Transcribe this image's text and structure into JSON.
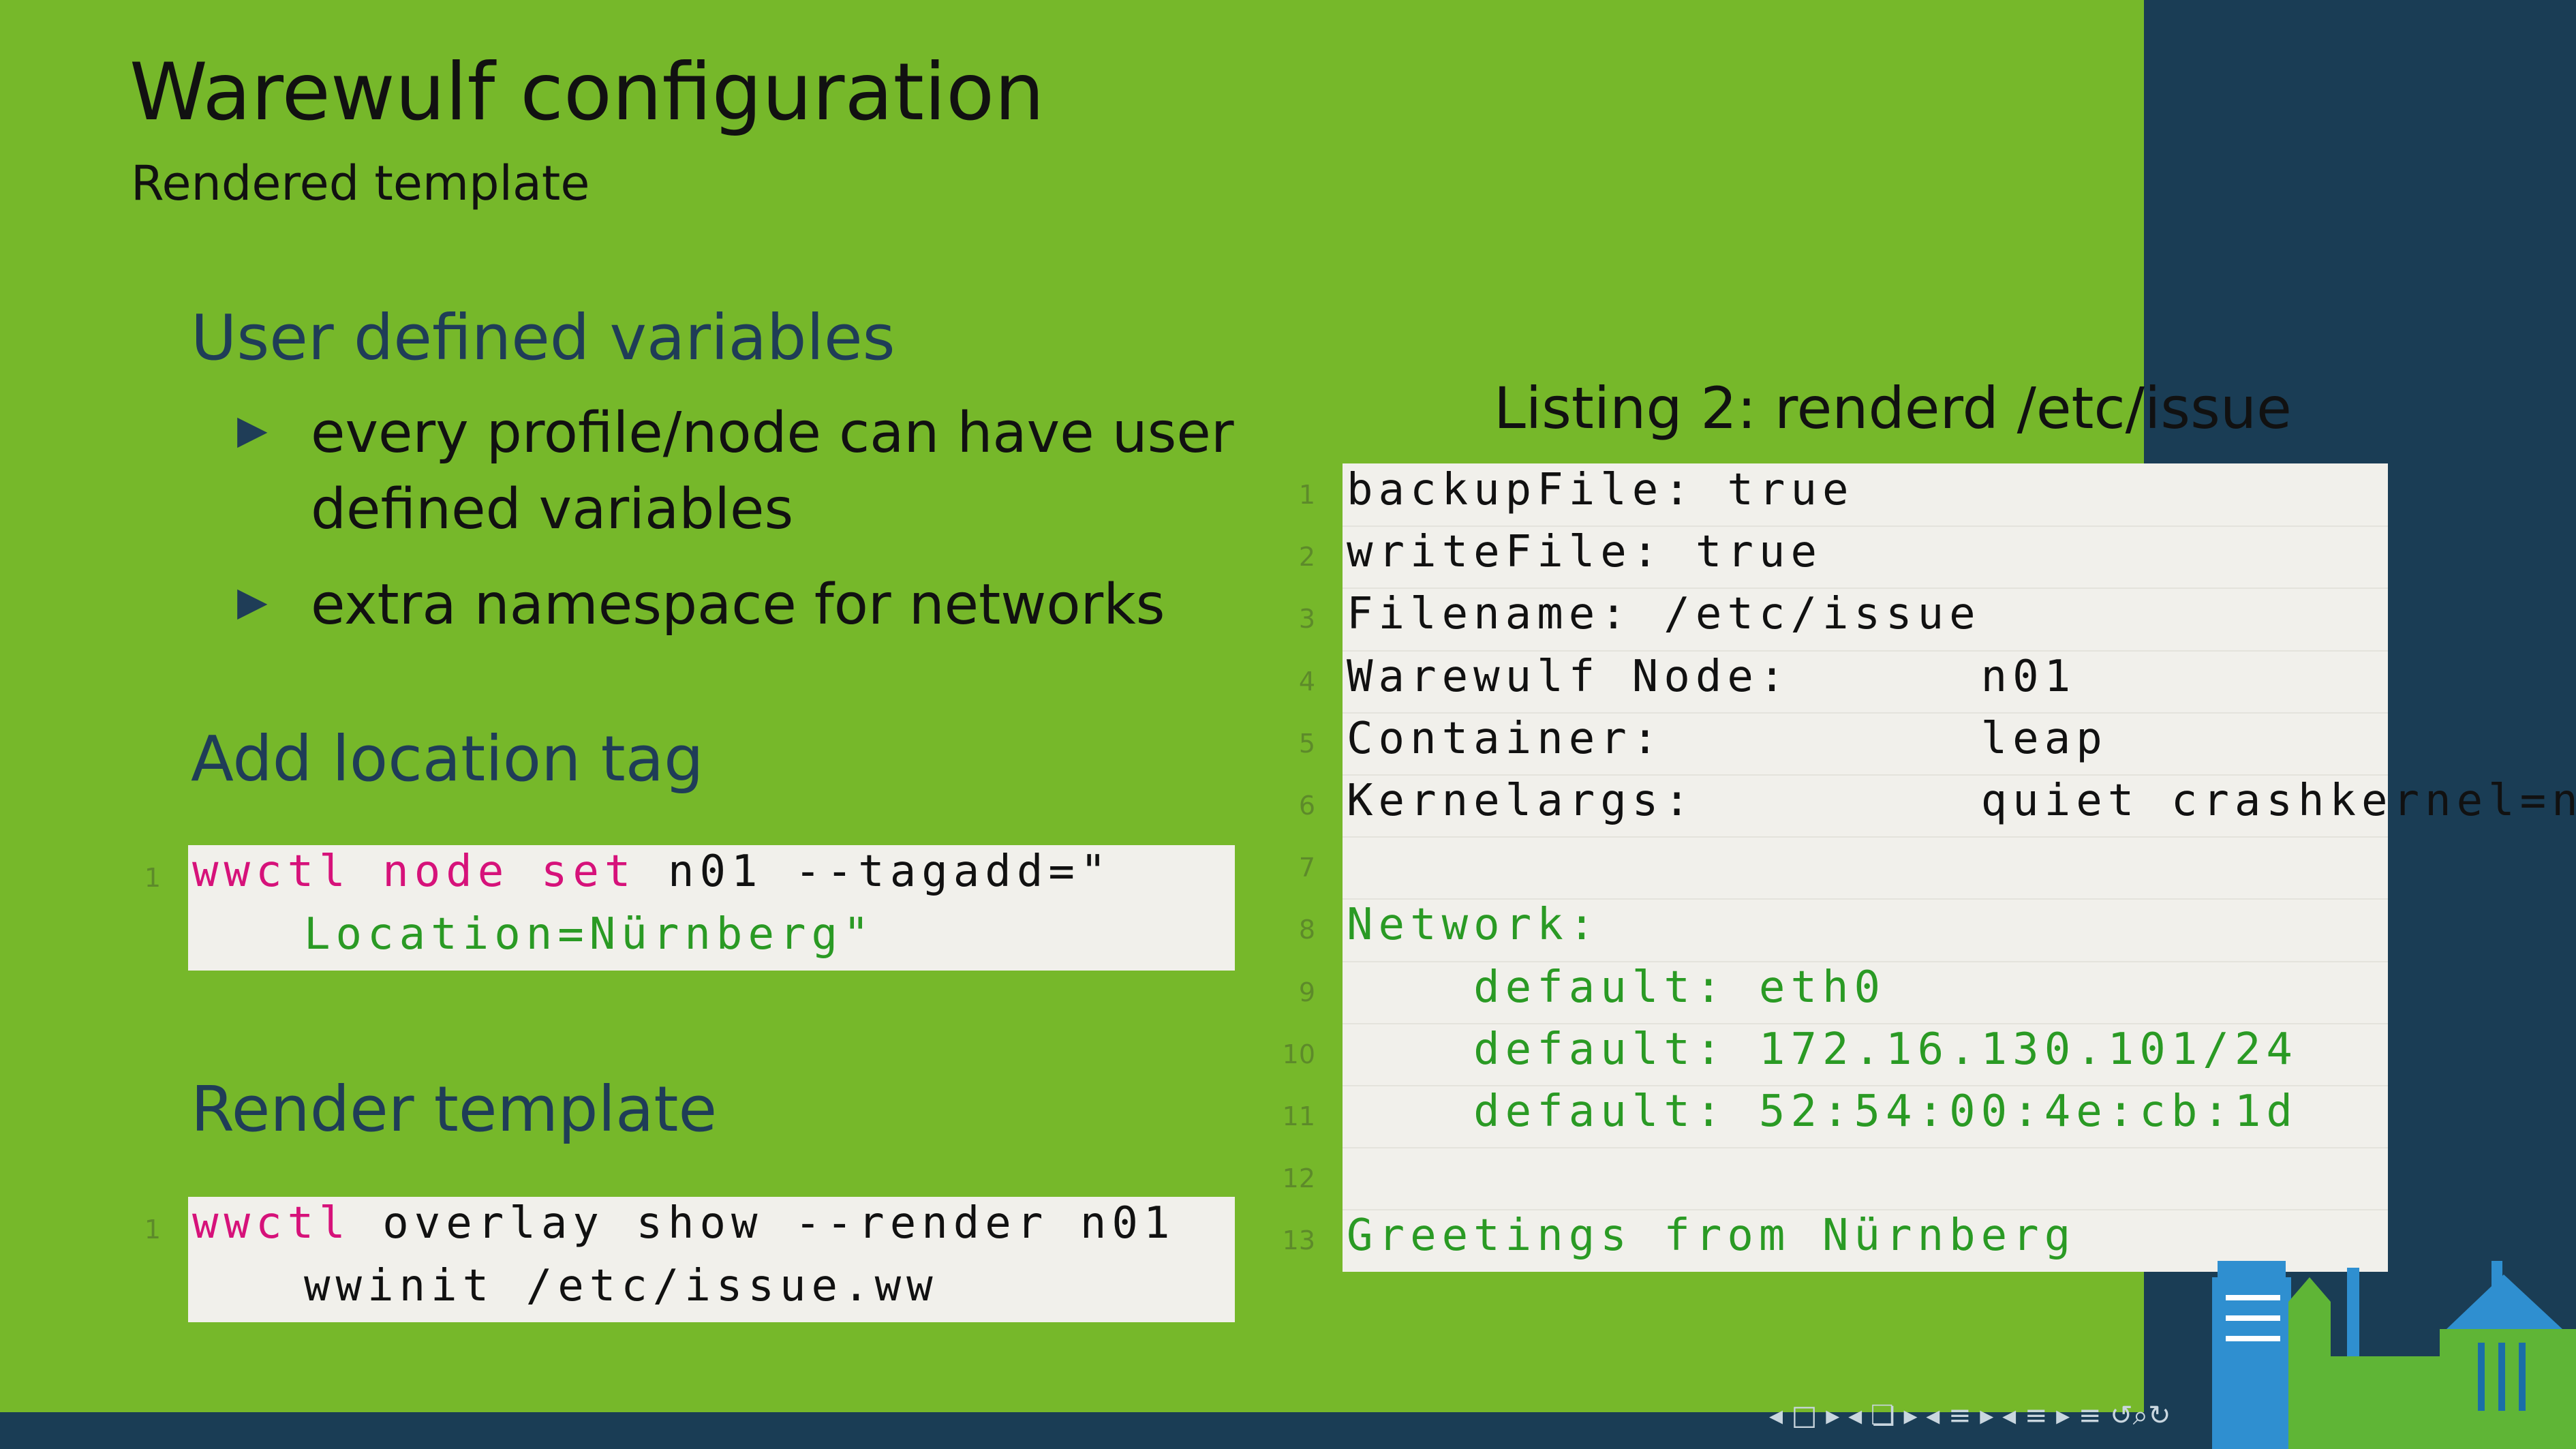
{
  "slide": {
    "title": "Warewulf configuration",
    "subtitle": "Rendered template"
  },
  "sections": [
    {
      "heading": "User defined variables",
      "bullets": [
        [
          "every profile/node can have user",
          "defined variables"
        ],
        [
          "extra namespace for networks"
        ]
      ]
    },
    {
      "heading": "Add location tag",
      "code": {
        "line_number": "1",
        "command": "wwctl",
        "subcommand": "node",
        "action": "set",
        "args": "n01 --tagadd=\"",
        "continuation": "Location=Nürnberg\""
      }
    },
    {
      "heading": "Render template",
      "code": {
        "line_number": "1",
        "command": "wwctl",
        "args": "overlay show --render n01",
        "continuation": "wwinit /etc/issue.ww"
      }
    }
  ],
  "listing": {
    "caption": "Listing 2: renderd /etc/issue",
    "lines": [
      {
        "n": "1",
        "text": "backupFile: true",
        "color": "default"
      },
      {
        "n": "2",
        "text": "writeFile: true",
        "color": "default"
      },
      {
        "n": "3",
        "text": "Filename: /etc/issue",
        "color": "default"
      },
      {
        "n": "4",
        "text": "Warewulf Node:      n01",
        "color": "default"
      },
      {
        "n": "5",
        "text": "Container:          leap",
        "color": "default"
      },
      {
        "n": "6",
        "text": "Kernelargs:         quiet crashkernel=n",
        "color": "default"
      },
      {
        "n": "7",
        "text": "",
        "color": "default"
      },
      {
        "n": "8",
        "text": "Network:",
        "color": "green"
      },
      {
        "n": "9",
        "text": "    default: eth0",
        "color": "green"
      },
      {
        "n": "10",
        "text": "    default: 172.16.130.101/24",
        "color": "green"
      },
      {
        "n": "11",
        "text": "    default: 52:54:00:4e:cb:1d",
        "color": "green"
      },
      {
        "n": "12",
        "text": "",
        "color": "green"
      },
      {
        "n": "13",
        "text": "Greetings from Nürnberg",
        "color": "green"
      }
    ]
  },
  "colors": {
    "background": "#76b82a",
    "panel": "#1a3d55",
    "heading": "#1f3d57",
    "keyword": "#d6127a",
    "green_text": "#2a9a24",
    "code_bg": "#f1f0eb"
  },
  "icons": [
    "bullet-triangle-icon",
    "navigation-controls-icon",
    "nuremberg-skyline-icon"
  ]
}
